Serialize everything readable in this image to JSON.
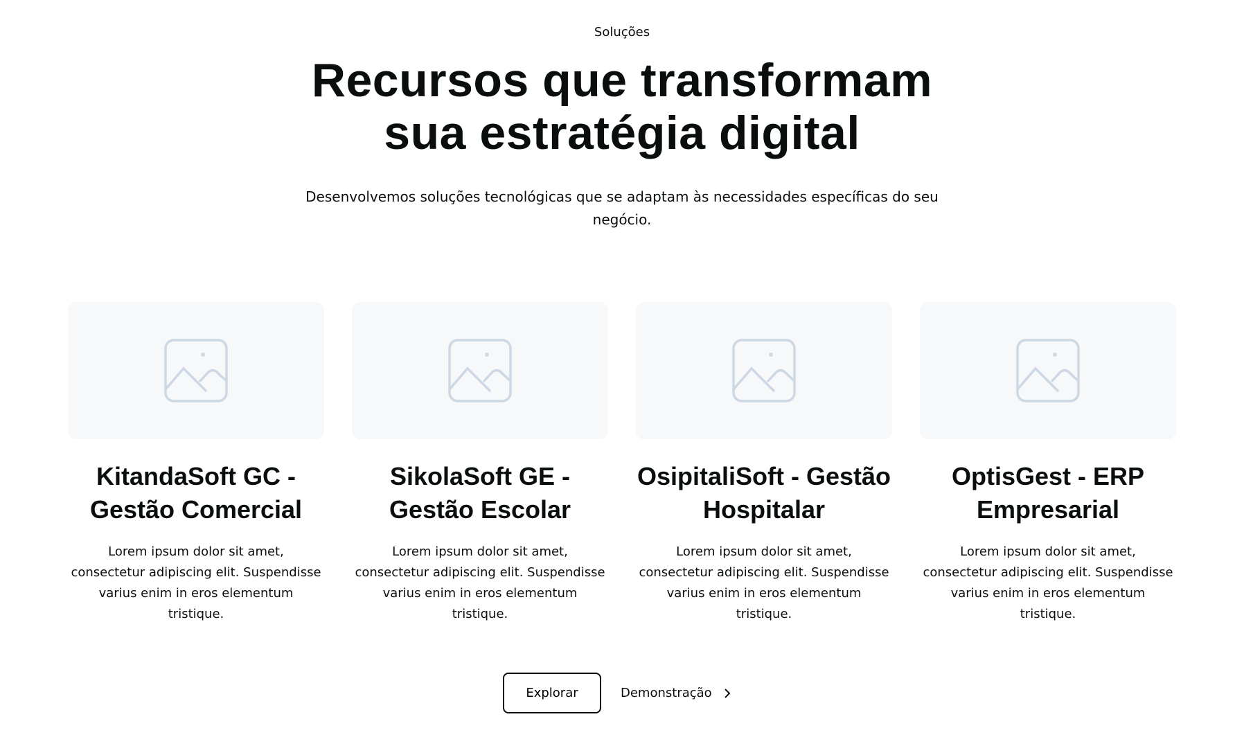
{
  "section": {
    "tagline": "Soluções",
    "title_line1": "Recursos que transformam",
    "title_line2": "sua estratégia digital",
    "subtitle": "Desenvolvemos soluções tecnológicas que se adaptam às necessidades específicas do seu negócio."
  },
  "cards": [
    {
      "title": "KitandaSoft GC - Gestão Comercial",
      "description": "Lorem ipsum dolor sit amet, consectetur adipiscing elit. Suspendisse varius enim in eros elementum tristique.",
      "icon": "image-placeholder-icon"
    },
    {
      "title": "SikolaSoft GE - Gestão Escolar",
      "description": "Lorem ipsum dolor sit amet, consectetur adipiscing elit. Suspendisse varius enim in eros elementum tristique.",
      "icon": "image-placeholder-icon"
    },
    {
      "title": "OsipitaliSoft - Gestão Hospitalar",
      "description": "Lorem ipsum dolor sit amet, consectetur adipiscing elit. Suspendisse varius enim in eros elementum tristique.",
      "icon": "image-placeholder-icon"
    },
    {
      "title": "OptisGest - ERP Empresarial",
      "description": "Lorem ipsum dolor sit amet, consectetur adipiscing elit. Suspendisse varius enim in eros elementum tristique.",
      "icon": "image-placeholder-icon"
    }
  ],
  "actions": {
    "explore_label": "Explorar",
    "demo_label": "Demonstração",
    "demo_icon": "chevron-right-icon"
  },
  "colors": {
    "text": "#0a0f0c",
    "placeholder_bg": "#f6f8fa",
    "placeholder_icon": "#cdd8e4"
  }
}
